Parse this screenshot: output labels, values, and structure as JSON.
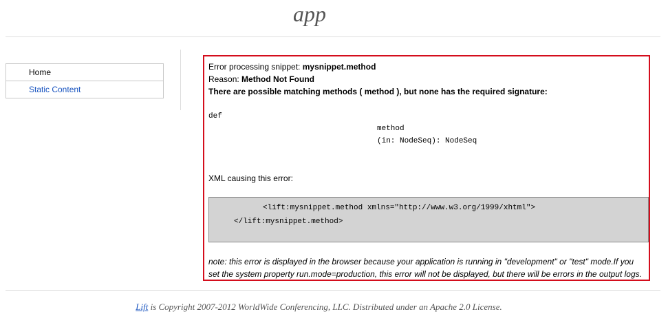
{
  "app": {
    "title": "app"
  },
  "sidebar": {
    "items": [
      {
        "label": "Home"
      },
      {
        "label": "Static Content"
      }
    ]
  },
  "error": {
    "processing_prefix": "Error processing snippet: ",
    "snippet_name": "mysnippet.method",
    "reason_prefix": "Reason: ",
    "reason": "Method Not Found",
    "matching_message": "There are possible matching methods ( method ), but none has the required signature:",
    "signature": {
      "keyword": "def",
      "method_name": "method",
      "params": "(in: NodeSeq): NodeSeq"
    },
    "xml_label": "XML causing this error:",
    "xml_lines": [
      "<lift:mysnippet.method xmlns=\"http://www.w3.org/1999/xhtml\">",
      "</lift:mysnippet.method>"
    ],
    "note_line1": "note: this error is displayed in the browser because your application is running in \"development\" or \"test\" mode.If you",
    "note_line2": "set the system property run.mode=production, this error will not be displayed, but there will be errors in the output logs."
  },
  "footer": {
    "link_text": "Lift",
    "text": " is Copyright 2007-2012 WorldWide Conferencing, LLC. Distributed under an Apache 2.0 License."
  },
  "colors": {
    "error_border": "#d40d1c",
    "link": "#1a55c0",
    "code_background": "#d3d3d3"
  }
}
